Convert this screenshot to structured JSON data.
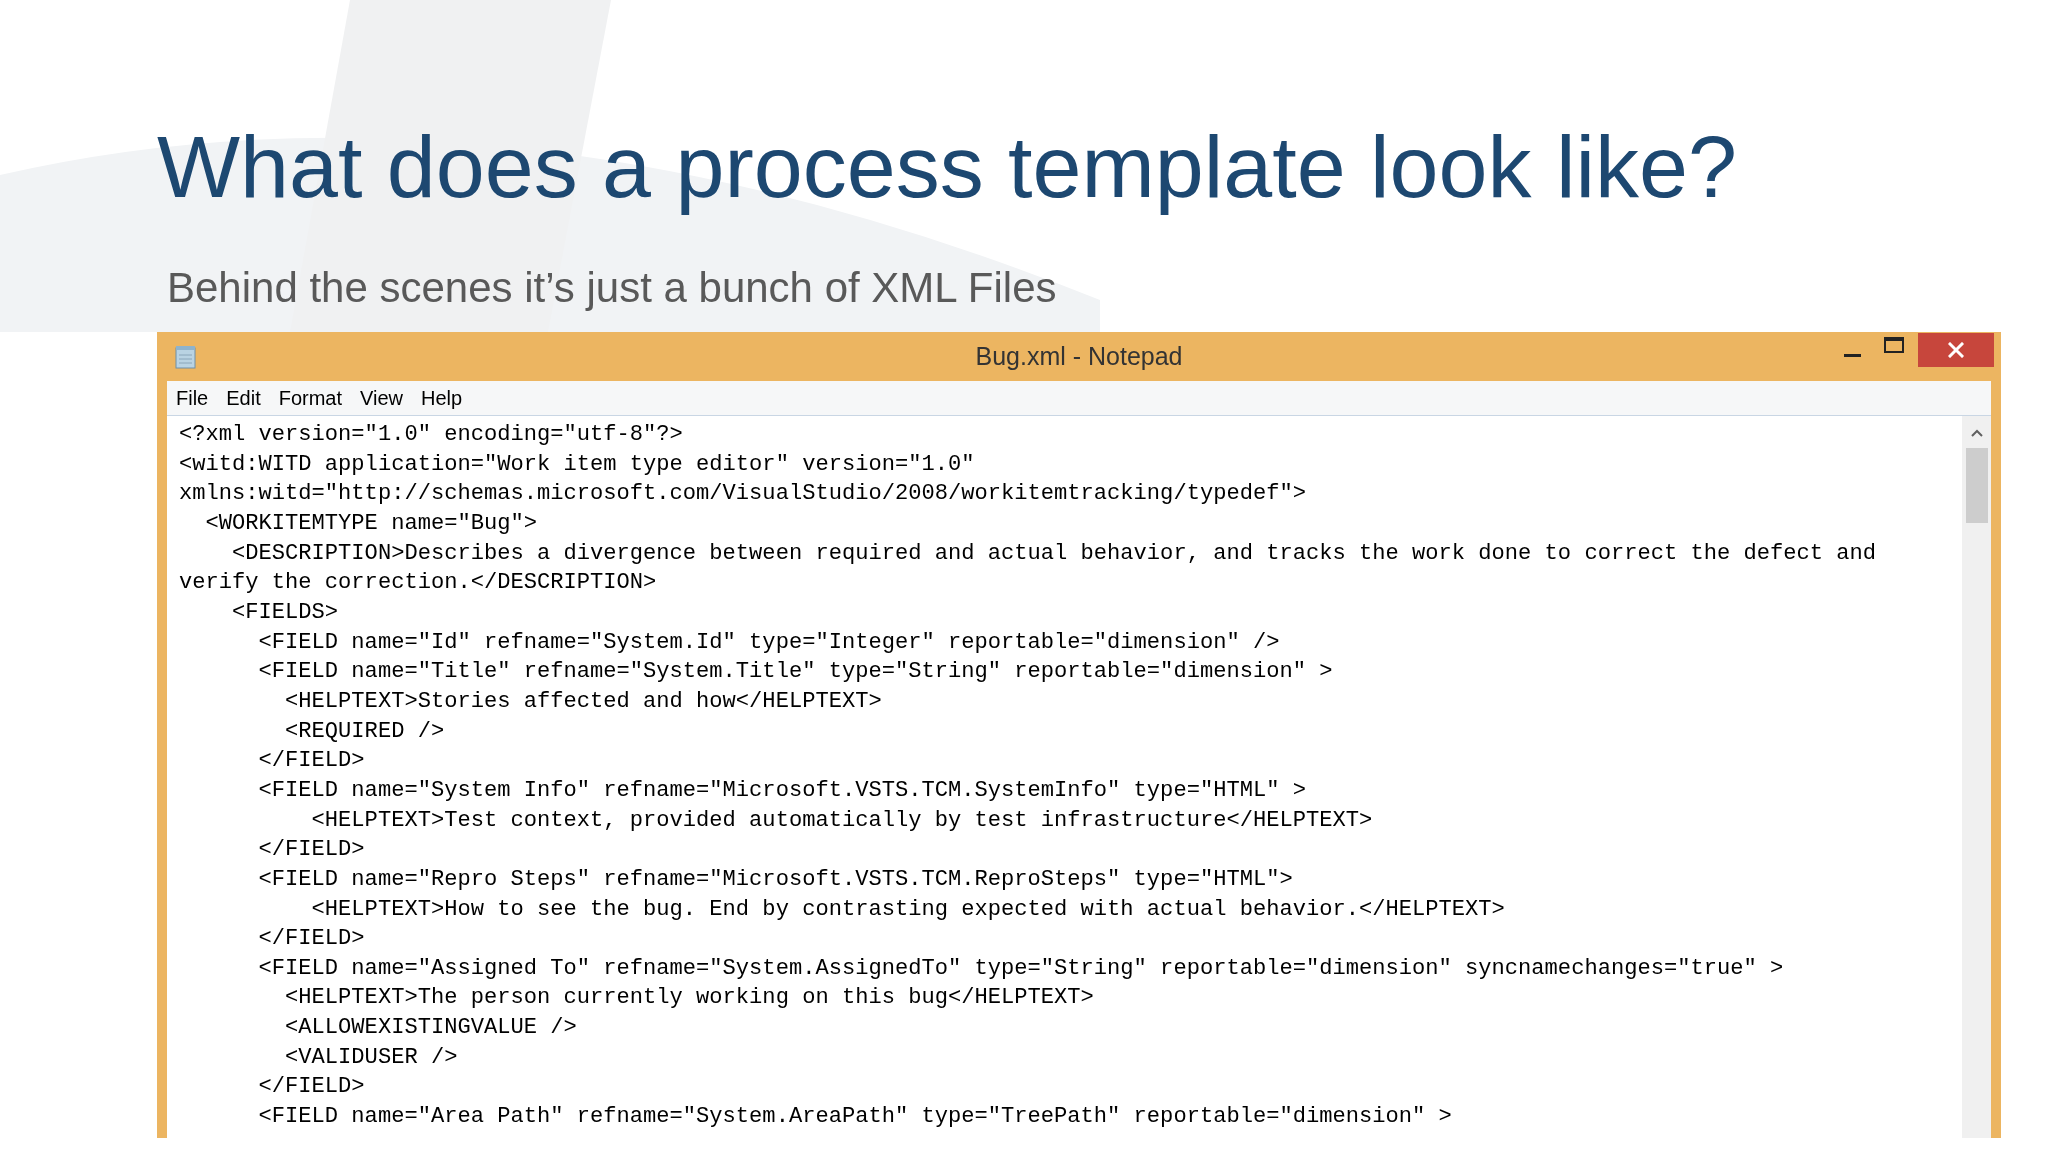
{
  "slide": {
    "title": "What does a process template look like?",
    "subtitle": "Behind the scenes it’s just a bunch of XML Files"
  },
  "window": {
    "title": "Bug.xml - Notepad",
    "menu": [
      "File",
      "Edit",
      "Format",
      "View",
      "Help"
    ],
    "lines": [
      "<?xml version=\"1.0\" encoding=\"utf-8\"?>",
      "<witd:WITD application=\"Work item type editor\" version=\"1.0\"",
      "xmlns:witd=\"http://schemas.microsoft.com/VisualStudio/2008/workitemtracking/typedef\">",
      "  <WORKITEMTYPE name=\"Bug\">",
      "    <DESCRIPTION>Describes a divergence between required and actual behavior, and tracks the work done to correct the defect and",
      "verify the correction.</DESCRIPTION>",
      "    <FIELDS>",
      "      <FIELD name=\"Id\" refname=\"System.Id\" type=\"Integer\" reportable=\"dimension\" />",
      "      <FIELD name=\"Title\" refname=\"System.Title\" type=\"String\" reportable=\"dimension\" >",
      "        <HELPTEXT>Stories affected and how</HELPTEXT>",
      "        <REQUIRED />",
      "      </FIELD>",
      "      <FIELD name=\"System Info\" refname=\"Microsoft.VSTS.TCM.SystemInfo\" type=\"HTML\" >",
      "          <HELPTEXT>Test context, provided automatically by test infrastructure</HELPTEXT>",
      "      </FIELD>",
      "      <FIELD name=\"Repro Steps\" refname=\"Microsoft.VSTS.TCM.ReproSteps\" type=\"HTML\">",
      "          <HELPTEXT>How to see the bug. End by contrasting expected with actual behavior.</HELPTEXT>",
      "      </FIELD>",
      "      <FIELD name=\"Assigned To\" refname=\"System.AssignedTo\" type=\"String\" reportable=\"dimension\" syncnamechanges=\"true\" >",
      "        <HELPTEXT>The person currently working on this bug</HELPTEXT>",
      "        <ALLOWEXISTINGVALUE />",
      "        <VALIDUSER />",
      "      </FIELD>",
      "      <FIELD name=\"Area Path\" refname=\"System.AreaPath\" type=\"TreePath\" reportable=\"dimension\" >"
    ]
  }
}
